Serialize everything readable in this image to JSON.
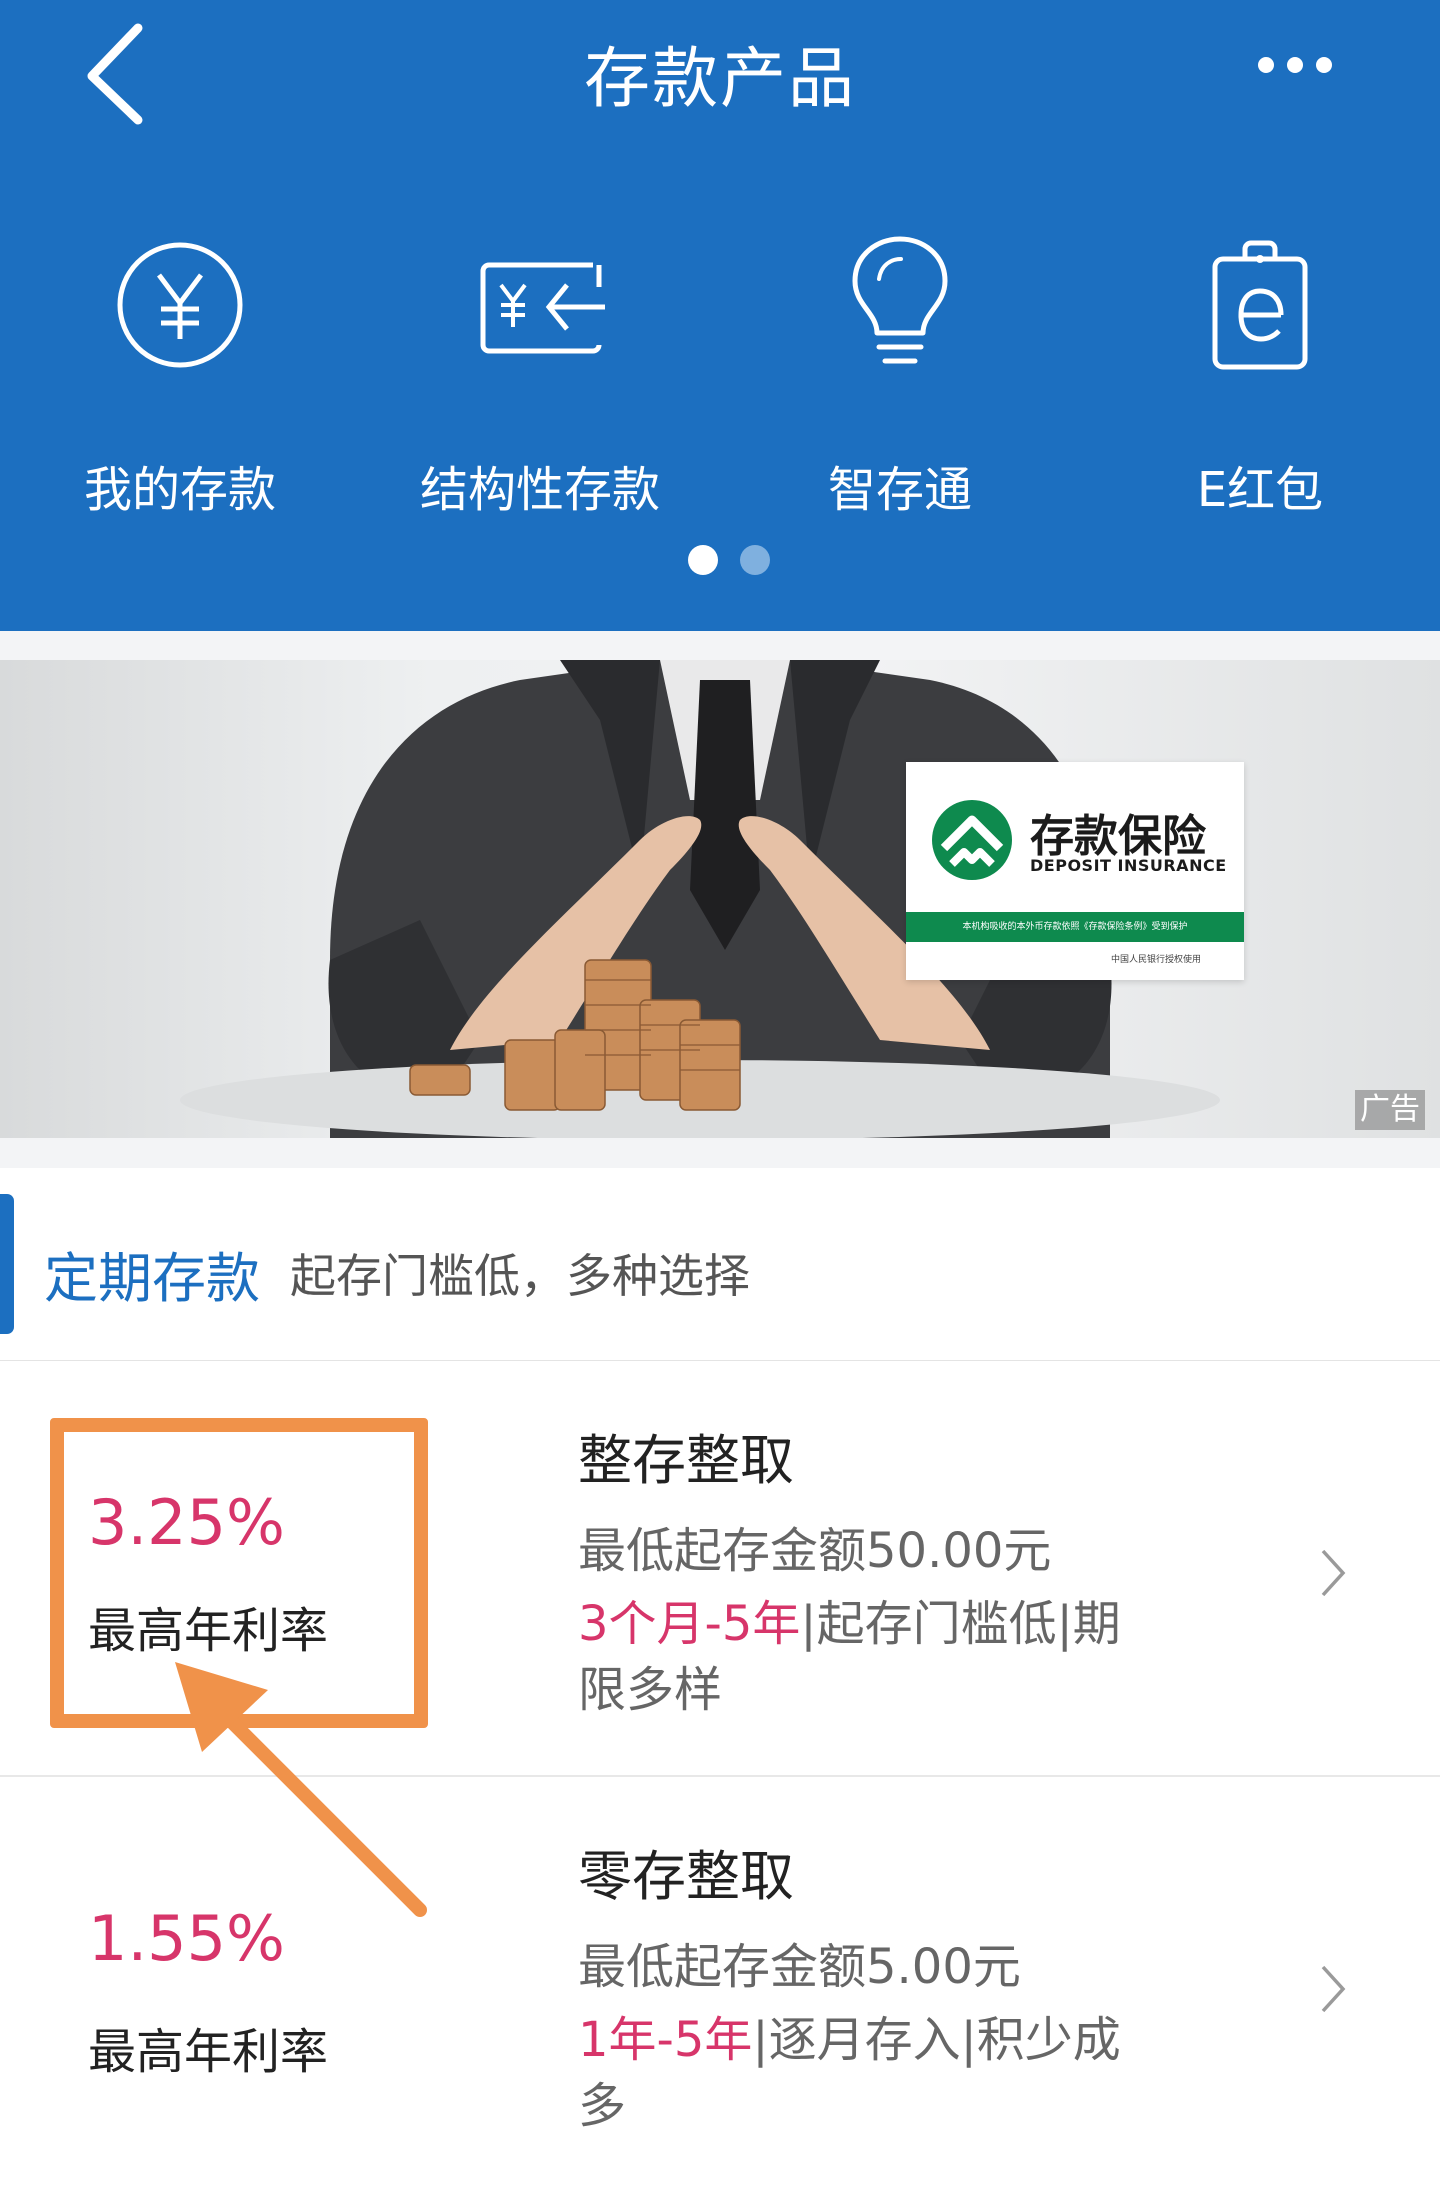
{
  "header": {
    "title": "存款产品",
    "back_icon": "back-arrow-icon",
    "more_icon": "more-dots-icon",
    "background_color": "#1c6fc0"
  },
  "quick_nav": {
    "items": [
      {
        "label": "我的存款",
        "icon": "yen-circle-icon"
      },
      {
        "label": "结构性存款",
        "icon": "yen-transfer-card-icon"
      },
      {
        "label": "智存通",
        "icon": "lightbulb-icon"
      },
      {
        "label": "E红包",
        "icon": "e-bag-icon"
      }
    ],
    "page_indicator": {
      "pages": 2,
      "active": 1
    }
  },
  "banner": {
    "insurance_title": "存款保险",
    "insurance_subtitle": "DEPOSIT INSURANCE",
    "insurance_strip": "本机构吸收的本外币存款依照《存款保险条例》受到保护",
    "insurance_footer": "中国人民银行授权使用",
    "ad_label": "广告",
    "brand_green": "#0e8a4e"
  },
  "section": {
    "title": "定期存款",
    "description": "起存门槛低，多种选择"
  },
  "products": [
    {
      "rate": "3.25%",
      "rate_label": "最高年利率",
      "name": "整存整取",
      "min_amount": "最低起存金额50.00元",
      "tag_highlight": "3个月-5年",
      "tag_rest": "|起存门槛低|期限多样"
    },
    {
      "rate": "1.55%",
      "rate_label": "最高年利率",
      "name": "零存整取",
      "min_amount": "最低起存金额5.00元",
      "tag_highlight": "1年-5年",
      "tag_rest": "|逐月存入|积少成多"
    }
  ],
  "colors": {
    "accent_blue": "#1c6fc0",
    "rate_pink": "#d7356a",
    "annotation_orange": "#f0924a"
  }
}
